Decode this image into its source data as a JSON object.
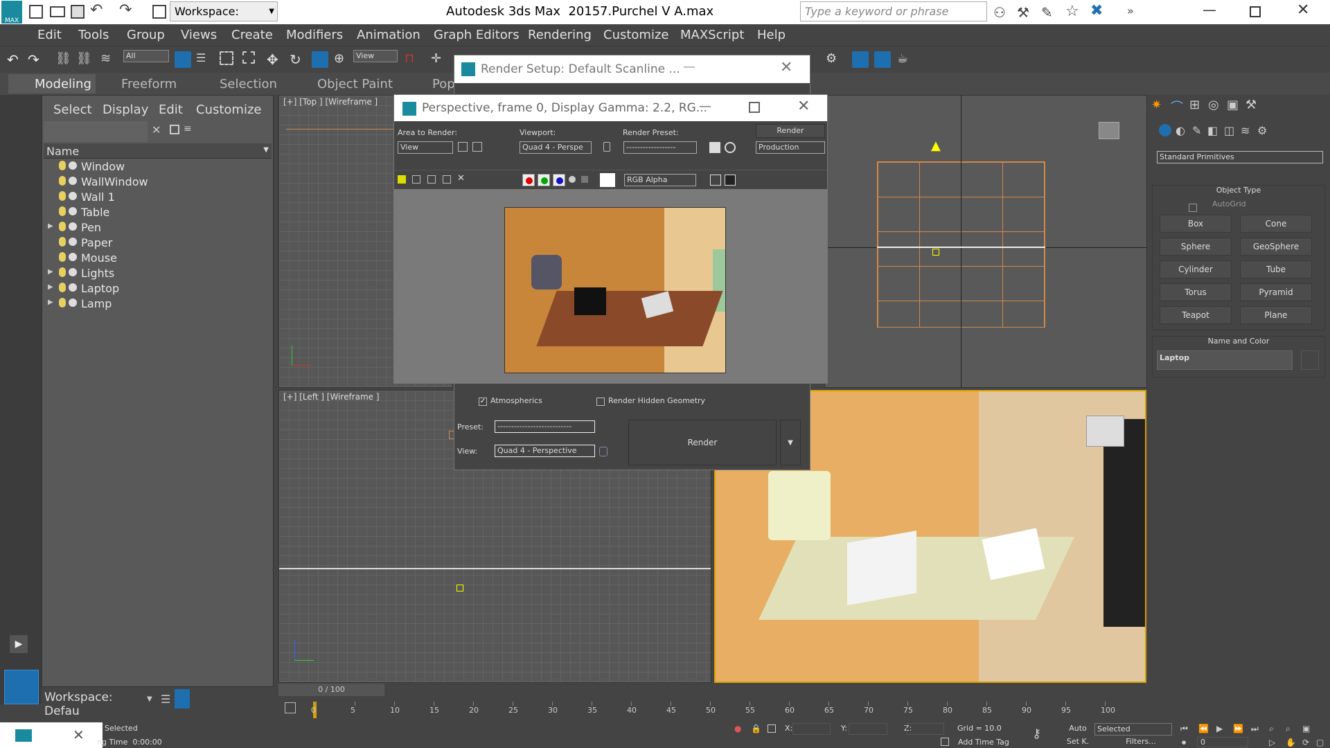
{
  "titlebar": {
    "app_title": "Autodesk 3ds Max  2015",
    "file_title": "7.Purchel V A.max",
    "workspace": "Workspace: Default",
    "search_placeholder": "Type a keyword or phrase"
  },
  "menu": [
    "Edit",
    "Tools",
    "Group",
    "Views",
    "Create",
    "Modifiers",
    "Animation",
    "Graph Editors",
    "Rendering",
    "Customize",
    "MAXScript",
    "Help"
  ],
  "toolbar": {
    "selection_filter": "All",
    "ref_coord": "View"
  },
  "ribbon_tabs": [
    "Modeling",
    "Freeform",
    "Selection",
    "Object Paint",
    "Pop"
  ],
  "scene_explorer": {
    "tabs": [
      "Select",
      "Display",
      "Edit",
      "Customize"
    ],
    "column": "Name",
    "items": [
      {
        "label": "Window",
        "expandable": false
      },
      {
        "label": "WallWindow",
        "expandable": false
      },
      {
        "label": "Wall 1",
        "expandable": false
      },
      {
        "label": "Table",
        "expandable": false
      },
      {
        "label": "Pen",
        "expandable": true
      },
      {
        "label": "Paper",
        "expandable": false
      },
      {
        "label": "Mouse",
        "expandable": false
      },
      {
        "label": "Lights",
        "expandable": true
      },
      {
        "label": "Laptop",
        "expandable": true
      },
      {
        "label": "Lamp",
        "expandable": true
      }
    ],
    "workspace": "Workspace: Defau"
  },
  "viewports": {
    "top_label": "[+] [Top ] [Wireframe ]",
    "left_label": "[+] [Left ] [Wireframe ]",
    "frame_counter": "0 / 100"
  },
  "render_setup": {
    "title": "Render Setup: Default Scanline ...",
    "atmospherics": "Atmospherics",
    "render_hidden": "Render Hidden Geometry",
    "preset_label": "Preset:",
    "preset_value": "---------------------------",
    "view_label": "View:",
    "view_value": "Quad 4 - Perspective",
    "render_button": "Render"
  },
  "frame_window": {
    "title": "Perspective, frame 0, Display Gamma: 2.2, RG...",
    "area_label": "Area to Render:",
    "area_value": "View",
    "viewport_label": "Viewport:",
    "viewport_value": "Quad 4 - Perspe",
    "preset_label": "Render Preset:",
    "preset_value": "------------------",
    "render_button": "Render",
    "production": "Production",
    "channel": "RGB Alpha"
  },
  "command_panel": {
    "category": "Standard Primitives",
    "object_type": "Object Type",
    "autogrid": "AutoGrid",
    "buttons": [
      "Box",
      "Cone",
      "Sphere",
      "GeoSphere",
      "Cylinder",
      "Tube",
      "Torus",
      "Pyramid",
      "Teapot",
      "Plane"
    ],
    "name_and_color": "Name and Color",
    "object_name": "Laptop"
  },
  "timeline": {
    "ticks": [
      "0",
      "5",
      "10",
      "15",
      "20",
      "25",
      "30",
      "35",
      "40",
      "45",
      "50",
      "55",
      "60",
      "65",
      "70",
      "75",
      "80",
      "85",
      "90",
      "95",
      "100"
    ]
  },
  "status": {
    "selected": "Selected",
    "time": "ng Time  0:00:00",
    "x_label": "X:",
    "y_label": "Y:",
    "z_label": "Z:",
    "grid": "Grid = 10.0",
    "add_time_tag": "Add Time Tag",
    "auto": "Auto",
    "selected_dd": "Selected",
    "set_k": "Set K.",
    "filters": "Filters...",
    "frame": "0"
  },
  "colors": {
    "accent": "#1e6fb0",
    "panel": "#444444",
    "orange_wire": "#d08a4a"
  }
}
